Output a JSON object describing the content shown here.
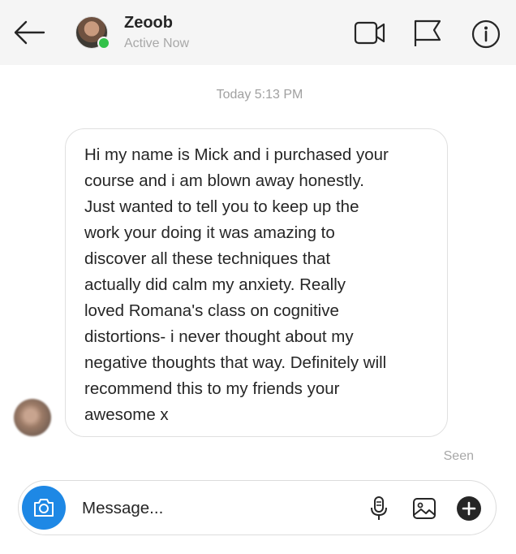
{
  "header": {
    "contact_name": "Zeoob",
    "status": "Active Now",
    "icons": {
      "back": "arrow-left-icon",
      "video": "video-camera-icon",
      "report": "flag-icon",
      "info": "info-icon"
    }
  },
  "conversation": {
    "timestamp": "Today 5:13 PM",
    "message_text": "Hi my name is Mick and i purchased your\ncourse and i am blown away honestly.\nJust wanted to tell you to keep up the\nwork your doing it was amazing to\ndiscover all these techniques that\nactually did calm my anxiety. Really\nloved Romana's class on cognitive\ndistortions- i never thought about my\nnegative thoughts that way. Definitely will\nrecommend this to my friends your\nawesome x",
    "seen_label": "Seen"
  },
  "composer": {
    "placeholder": "Message...",
    "icons": [
      "camera-icon",
      "microphone-icon",
      "image-icon",
      "plus-icon"
    ]
  },
  "colors": {
    "header_bg": "#f5f5f5",
    "online": "#33c24a",
    "camera_button": "#1e88e5",
    "muted_text": "#a8a8a8"
  }
}
